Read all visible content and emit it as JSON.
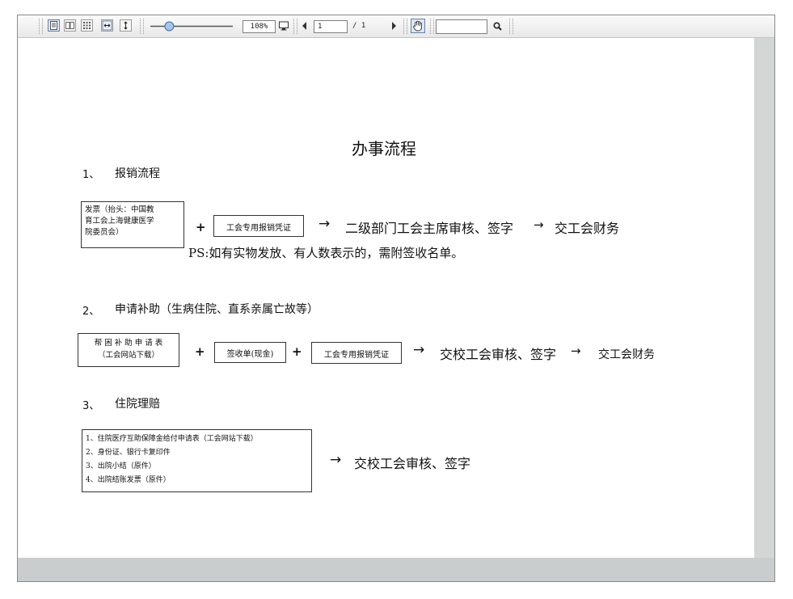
{
  "toolbar": {
    "zoom": "108%",
    "slider_value": 0.2,
    "page_current": "1",
    "page_total": "/ 1",
    "search_value": ""
  },
  "document": {
    "title": "办事流程",
    "sec1": {
      "heading_num": "1、",
      "heading_text": "报销流程",
      "box1_lines": [
        "发票（抬头：中国教",
        "育工会上海健康医学",
        "院委员会）"
      ],
      "plus": "+",
      "box2": "工会专用报销凭证",
      "arrow1": "→",
      "step1": "二级部门工会主席审核、签字",
      "arrow2": "→",
      "step2": "交工会财务",
      "ps": "PS:如有实物发放、有人数表示的，需附签收名单。"
    },
    "sec2": {
      "heading_num": "2、",
      "heading_text": "申请补助（生病住院、直系亲属亡故等）",
      "box1_lines": [
        "帮 困 补 助 申 请 表",
        "（工会网站下载）"
      ],
      "plus1": "+",
      "box2": "签收单(现金)",
      "plus2": "+",
      "box3": "工会专用报销凭证",
      "arrow1": "→",
      "step1": "交校工会审核、签字",
      "arrow2": "→",
      "step2": "交工会财务"
    },
    "sec3": {
      "heading_num": "3、",
      "heading_text": "住院理赔",
      "box_lines": [
        "1、住院医疗互助保障金给付申请表（工会网站下载）",
        "2、身份证、银行卡复印件",
        "3、出院小结（原件）",
        "4、出院结账发票（原件）"
      ],
      "arrow": "→",
      "step": "交校工会审核、签字"
    }
  }
}
